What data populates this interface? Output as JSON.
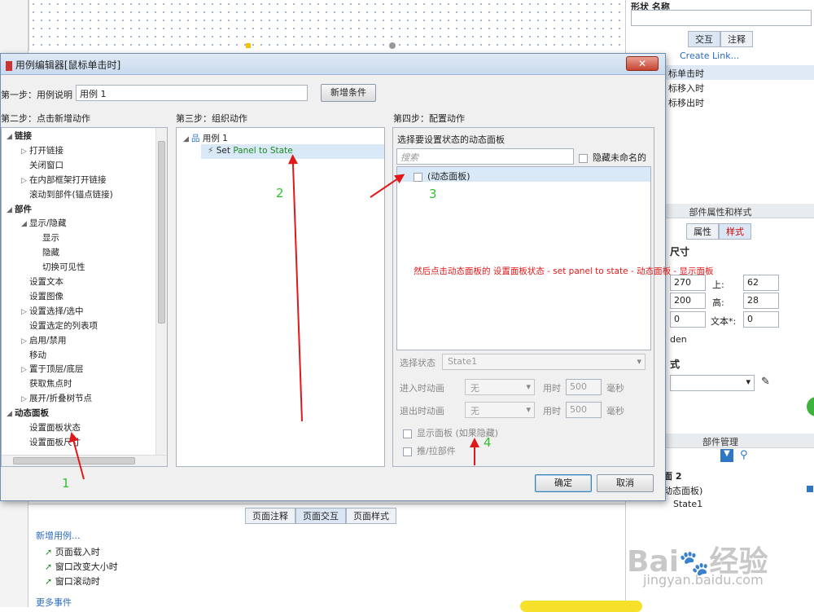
{
  "background": {
    "left_strip": {},
    "right_panel": {
      "shape_name_label": "形状 名称",
      "tab_interaction": "交互",
      "tab_notes": "注释",
      "create_link": "Create Link...",
      "events": [
        "标单击时",
        "标移入时",
        "标移出时"
      ],
      "props_title": "部件属性和样式",
      "props_tab_attr": "属性",
      "props_tab_style": "样式",
      "size_label": "尺寸",
      "x_val": "270",
      "top_label": "上:",
      "top_val": "62",
      "w_val": "200",
      "h_label": "高:",
      "h_val": "28",
      "zero_val": "0",
      "text_label": "文本*:",
      "text_val": "0",
      "hidden_partial": "den",
      "style_partial": "式",
      "parts_title": "部件管理",
      "parts_page": "面 2",
      "parts_panel": "动态面板)",
      "parts_state": "State1"
    },
    "bottom_panel": {
      "tabs": [
        "页面注释",
        "页面交互",
        "页面样式"
      ],
      "add_case": "新增用例...",
      "events": [
        "页面载入时",
        "窗口改变大小时",
        "窗口滚动时"
      ],
      "more_events": "更多事件"
    },
    "watermark": {
      "brand": "Bai",
      "brand2": "经验",
      "url": "jingyan.baidu.com"
    }
  },
  "dialog": {
    "title": "用例编辑器[鼠标单击时]",
    "close_glyph": "✕",
    "step1_label": "第一步：用例说明",
    "step1_value": "用例 1",
    "add_condition": "新增条件",
    "step2_label": "第二步：点击新增动作",
    "step3_label": "第三步：组织动作",
    "step4_label": "第四步：配置动作",
    "actions_tree": [
      {
        "label": "链接",
        "level": 0,
        "bold": true,
        "expander": "◢"
      },
      {
        "label": "打开链接",
        "level": 1,
        "expander": "▷"
      },
      {
        "label": "关闭窗口",
        "level": 1,
        "expander": ""
      },
      {
        "label": "在内部框架打开链接",
        "level": 1,
        "expander": "▷"
      },
      {
        "label": "滚动到部件(锚点链接)",
        "level": 1,
        "expander": ""
      },
      {
        "label": "部件",
        "level": 0,
        "bold": true,
        "expander": "◢"
      },
      {
        "label": "显示/隐藏",
        "level": 1,
        "expander": "◢"
      },
      {
        "label": "显示",
        "level": 2,
        "expander": ""
      },
      {
        "label": "隐藏",
        "level": 2,
        "expander": ""
      },
      {
        "label": "切换可见性",
        "level": 2,
        "expander": ""
      },
      {
        "label": "设置文本",
        "level": 1,
        "expander": ""
      },
      {
        "label": "设置图像",
        "level": 1,
        "expander": ""
      },
      {
        "label": "设置选择/选中",
        "level": 1,
        "expander": "▷"
      },
      {
        "label": "设置选定的列表项",
        "level": 1,
        "expander": ""
      },
      {
        "label": "启用/禁用",
        "level": 1,
        "expander": "▷"
      },
      {
        "label": "移动",
        "level": 1,
        "expander": ""
      },
      {
        "label": "置于顶层/底层",
        "level": 1,
        "expander": "▷"
      },
      {
        "label": "获取焦点时",
        "level": 1,
        "expander": ""
      },
      {
        "label": "展开/折叠树节点",
        "level": 1,
        "expander": "▷"
      },
      {
        "label": "动态面板",
        "level": 0,
        "bold": true,
        "expander": "◢"
      },
      {
        "label": "设置面板状态",
        "level": 1,
        "expander": ""
      },
      {
        "label": "设置面板尺寸",
        "level": 1,
        "expander": ""
      }
    ],
    "case_root": "用例 1",
    "case_action_prefix": "Set",
    "case_action_text": "Panel to State",
    "select_panel_label": "选择要设置状态的动态面板",
    "search_placeholder": "搜索",
    "hide_unnamed": "隐藏未命名的",
    "panel_item": "(动态面板)",
    "annotation": "然后点击动态面板的 设置面板状态 - set panel to state - 动态面板 - 显示面板",
    "select_state_label": "选择状态",
    "select_state_value": "State1",
    "enter_anim_label": "进入时动画",
    "exit_anim_label": "退出时动画",
    "anim_value": "无",
    "duration_label": "用时",
    "duration_value": "500",
    "ms_label": "毫秒",
    "show_panel_label": "显示面板 (如果隐藏)",
    "push_pull_label": "推/拉部件",
    "ok": "确定",
    "cancel": "取消",
    "markers": [
      "1",
      "2",
      "3",
      "4"
    ]
  },
  "colors": {
    "arrow": "#e01818",
    "marker": "#30c030",
    "accent": "#d9e9f8",
    "close": "#c7432f"
  }
}
